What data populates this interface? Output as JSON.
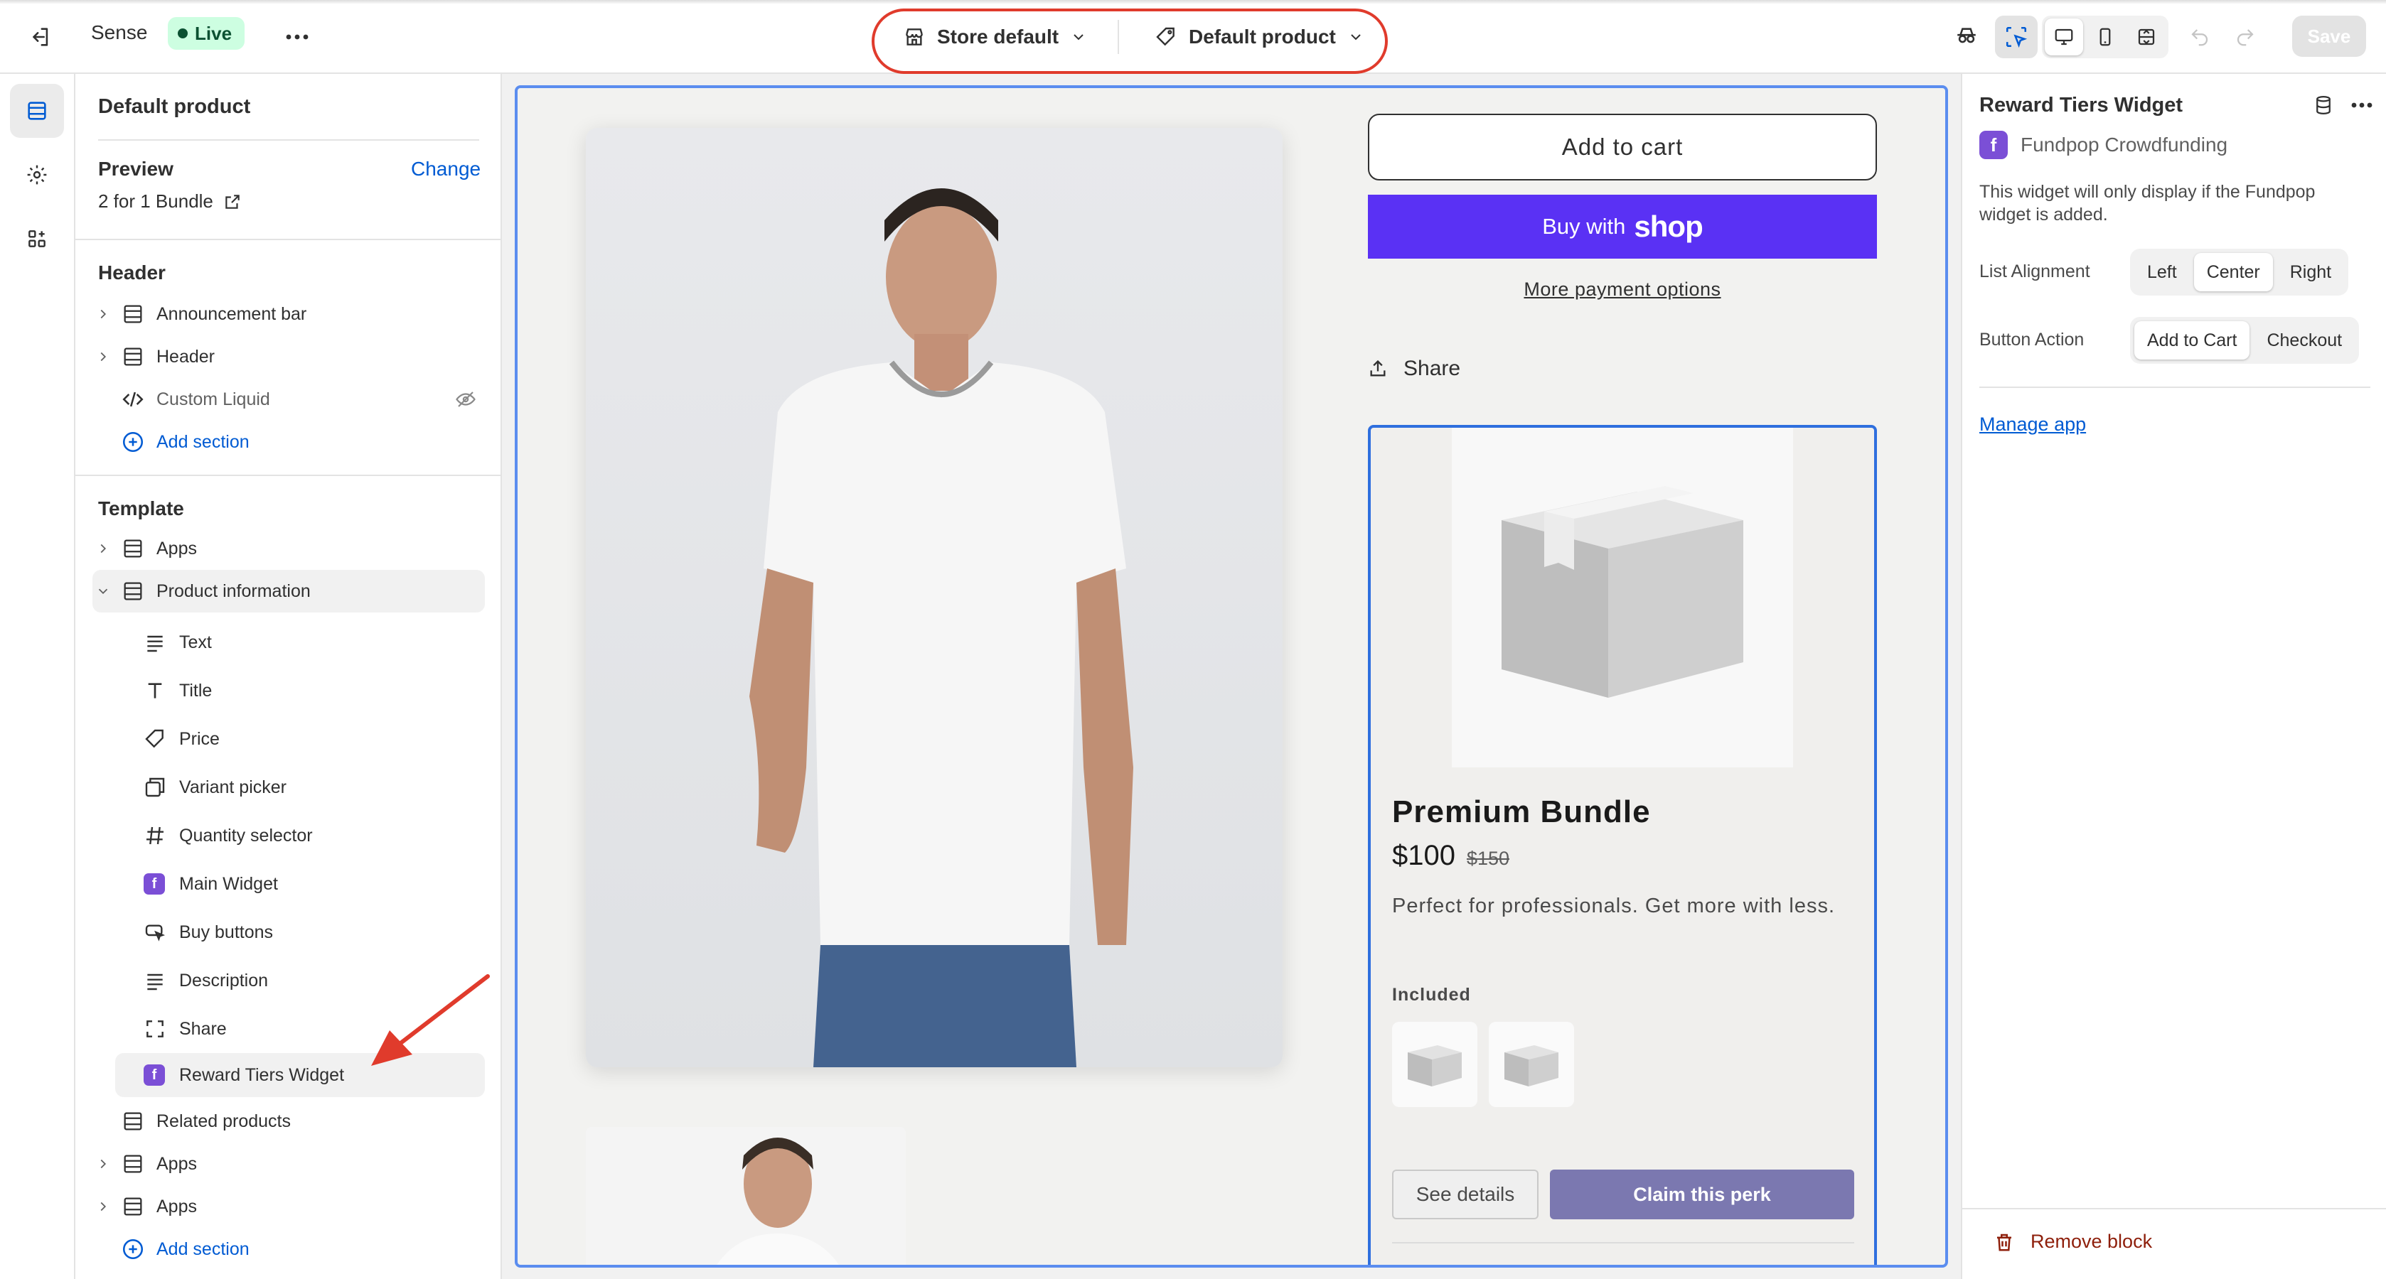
{
  "topbar": {
    "theme_name": "Sense",
    "live_badge": "Live",
    "store_selector": "Store default",
    "product_selector": "Default product",
    "save_label": "Save"
  },
  "left_panel": {
    "title": "Default product",
    "preview_label": "Preview",
    "change_label": "Change",
    "preview_value": "2 for 1 Bundle",
    "header_group": "Header",
    "header_items": [
      "Announcement bar",
      "Header",
      "Custom Liquid"
    ],
    "add_section": "Add section",
    "template_group": "Template",
    "template_items": {
      "apps": "Apps",
      "product_information": "Product information",
      "blocks": [
        "Text",
        "Title",
        "Price",
        "Variant picker",
        "Quantity selector",
        "Main Widget",
        "Buy buttons",
        "Description",
        "Share",
        "Reward Tiers Widget"
      ],
      "related_products": "Related products",
      "apps_2": "Apps",
      "apps_3": "Apps"
    },
    "add_section_2": "Add section"
  },
  "canvas": {
    "add_to_cart": "Add to cart",
    "buy_with": "Buy with",
    "shop_word": "shop",
    "more_payment": "More payment options",
    "share": "Share",
    "widget": {
      "title": "Premium Bundle",
      "price": "$100",
      "compare_price": "$150",
      "description": "Perfect for professionals. Get more with less.",
      "included_label": "Included",
      "see_details": "See details",
      "claim": "Claim this perk"
    }
  },
  "right_panel": {
    "title": "Reward Tiers Widget",
    "app_name": "Fundpop Crowdfunding",
    "note": "This widget will only display if the Fundpop widget is added.",
    "list_alignment_label": "List Alignment",
    "list_alignment_options": [
      "Left",
      "Center",
      "Right"
    ],
    "list_alignment_selected": "Center",
    "button_action_label": "Button Action",
    "button_action_options": [
      "Add to Cart",
      "Checkout"
    ],
    "button_action_selected": "Add to Cart",
    "manage_app": "Manage app",
    "remove_block": "Remove block"
  },
  "colors": {
    "accent_blue": "#005bd3",
    "live_green": "#cdfee1",
    "shop_purple": "#5a31f4",
    "claim_button": "#7b78b0",
    "annotation_red": "#e03b2c",
    "remove_red": "#8e1f0b"
  }
}
